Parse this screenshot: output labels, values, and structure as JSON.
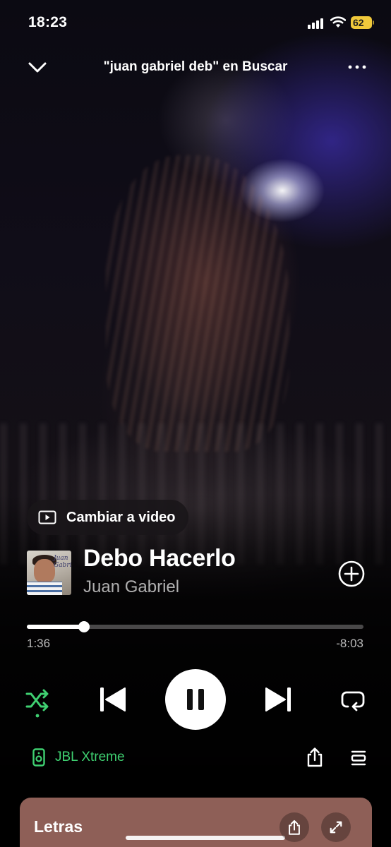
{
  "status_bar": {
    "time": "18:23",
    "battery_level": "62",
    "icons": [
      "cellular-signal-icon",
      "wifi-icon",
      "battery-charging-icon"
    ]
  },
  "header": {
    "context_title": "\"juan gabriel deb\" en Buscar",
    "icons": [
      "chevron-down-icon",
      "more-options-icon"
    ]
  },
  "video_switch": {
    "label": "Cambiar a video",
    "icon": "video-icon"
  },
  "track": {
    "title": "Debo Hacerlo",
    "artist": "Juan Gabriel",
    "album_art_text": "Juan Gabriel"
  },
  "playback": {
    "elapsed": "1:36",
    "remaining": "-8:03",
    "progress_fraction": 0.17,
    "is_playing": true
  },
  "controls": {
    "shuffle_active": true,
    "icons": [
      "shuffle-icon",
      "previous-track-icon",
      "pause-icon",
      "next-track-icon",
      "repeat-icon"
    ]
  },
  "device": {
    "name": "JBL Xtreme",
    "icon": "speaker-icon"
  },
  "bottom_actions": [
    "share-icon",
    "queue-icon"
  ],
  "lyrics_card": {
    "label": "Letras",
    "icons": [
      "share-icon",
      "expand-icon"
    ]
  },
  "colors": {
    "accent_green": "#3fd071",
    "lyrics_card_bg": "#8e5f57",
    "battery_yellow": "#f1c93b"
  }
}
